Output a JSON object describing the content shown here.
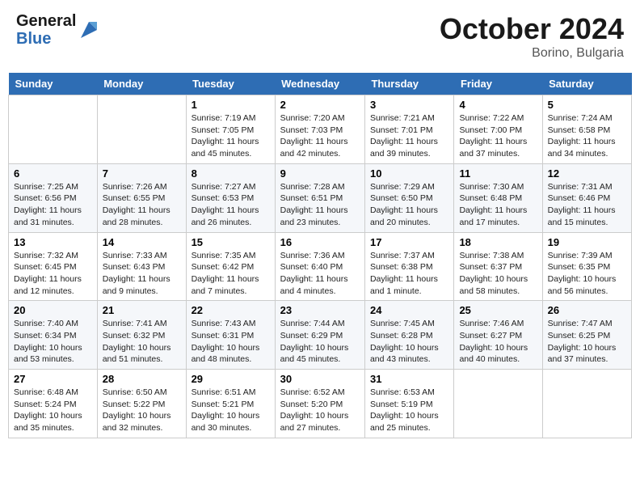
{
  "header": {
    "logo_line1": "General",
    "logo_line2": "Blue",
    "month": "October 2024",
    "location": "Borino, Bulgaria"
  },
  "weekdays": [
    "Sunday",
    "Monday",
    "Tuesday",
    "Wednesday",
    "Thursday",
    "Friday",
    "Saturday"
  ],
  "weeks": [
    [
      {
        "day": "",
        "info": ""
      },
      {
        "day": "",
        "info": ""
      },
      {
        "day": "1",
        "info": "Sunrise: 7:19 AM\nSunset: 7:05 PM\nDaylight: 11 hours and 45 minutes."
      },
      {
        "day": "2",
        "info": "Sunrise: 7:20 AM\nSunset: 7:03 PM\nDaylight: 11 hours and 42 minutes."
      },
      {
        "day": "3",
        "info": "Sunrise: 7:21 AM\nSunset: 7:01 PM\nDaylight: 11 hours and 39 minutes."
      },
      {
        "day": "4",
        "info": "Sunrise: 7:22 AM\nSunset: 7:00 PM\nDaylight: 11 hours and 37 minutes."
      },
      {
        "day": "5",
        "info": "Sunrise: 7:24 AM\nSunset: 6:58 PM\nDaylight: 11 hours and 34 minutes."
      }
    ],
    [
      {
        "day": "6",
        "info": "Sunrise: 7:25 AM\nSunset: 6:56 PM\nDaylight: 11 hours and 31 minutes."
      },
      {
        "day": "7",
        "info": "Sunrise: 7:26 AM\nSunset: 6:55 PM\nDaylight: 11 hours and 28 minutes."
      },
      {
        "day": "8",
        "info": "Sunrise: 7:27 AM\nSunset: 6:53 PM\nDaylight: 11 hours and 26 minutes."
      },
      {
        "day": "9",
        "info": "Sunrise: 7:28 AM\nSunset: 6:51 PM\nDaylight: 11 hours and 23 minutes."
      },
      {
        "day": "10",
        "info": "Sunrise: 7:29 AM\nSunset: 6:50 PM\nDaylight: 11 hours and 20 minutes."
      },
      {
        "day": "11",
        "info": "Sunrise: 7:30 AM\nSunset: 6:48 PM\nDaylight: 11 hours and 17 minutes."
      },
      {
        "day": "12",
        "info": "Sunrise: 7:31 AM\nSunset: 6:46 PM\nDaylight: 11 hours and 15 minutes."
      }
    ],
    [
      {
        "day": "13",
        "info": "Sunrise: 7:32 AM\nSunset: 6:45 PM\nDaylight: 11 hours and 12 minutes."
      },
      {
        "day": "14",
        "info": "Sunrise: 7:33 AM\nSunset: 6:43 PM\nDaylight: 11 hours and 9 minutes."
      },
      {
        "day": "15",
        "info": "Sunrise: 7:35 AM\nSunset: 6:42 PM\nDaylight: 11 hours and 7 minutes."
      },
      {
        "day": "16",
        "info": "Sunrise: 7:36 AM\nSunset: 6:40 PM\nDaylight: 11 hours and 4 minutes."
      },
      {
        "day": "17",
        "info": "Sunrise: 7:37 AM\nSunset: 6:38 PM\nDaylight: 11 hours and 1 minute."
      },
      {
        "day": "18",
        "info": "Sunrise: 7:38 AM\nSunset: 6:37 PM\nDaylight: 10 hours and 58 minutes."
      },
      {
        "day": "19",
        "info": "Sunrise: 7:39 AM\nSunset: 6:35 PM\nDaylight: 10 hours and 56 minutes."
      }
    ],
    [
      {
        "day": "20",
        "info": "Sunrise: 7:40 AM\nSunset: 6:34 PM\nDaylight: 10 hours and 53 minutes."
      },
      {
        "day": "21",
        "info": "Sunrise: 7:41 AM\nSunset: 6:32 PM\nDaylight: 10 hours and 51 minutes."
      },
      {
        "day": "22",
        "info": "Sunrise: 7:43 AM\nSunset: 6:31 PM\nDaylight: 10 hours and 48 minutes."
      },
      {
        "day": "23",
        "info": "Sunrise: 7:44 AM\nSunset: 6:29 PM\nDaylight: 10 hours and 45 minutes."
      },
      {
        "day": "24",
        "info": "Sunrise: 7:45 AM\nSunset: 6:28 PM\nDaylight: 10 hours and 43 minutes."
      },
      {
        "day": "25",
        "info": "Sunrise: 7:46 AM\nSunset: 6:27 PM\nDaylight: 10 hours and 40 minutes."
      },
      {
        "day": "26",
        "info": "Sunrise: 7:47 AM\nSunset: 6:25 PM\nDaylight: 10 hours and 37 minutes."
      }
    ],
    [
      {
        "day": "27",
        "info": "Sunrise: 6:48 AM\nSunset: 5:24 PM\nDaylight: 10 hours and 35 minutes."
      },
      {
        "day": "28",
        "info": "Sunrise: 6:50 AM\nSunset: 5:22 PM\nDaylight: 10 hours and 32 minutes."
      },
      {
        "day": "29",
        "info": "Sunrise: 6:51 AM\nSunset: 5:21 PM\nDaylight: 10 hours and 30 minutes."
      },
      {
        "day": "30",
        "info": "Sunrise: 6:52 AM\nSunset: 5:20 PM\nDaylight: 10 hours and 27 minutes."
      },
      {
        "day": "31",
        "info": "Sunrise: 6:53 AM\nSunset: 5:19 PM\nDaylight: 10 hours and 25 minutes."
      },
      {
        "day": "",
        "info": ""
      },
      {
        "day": "",
        "info": ""
      }
    ]
  ]
}
